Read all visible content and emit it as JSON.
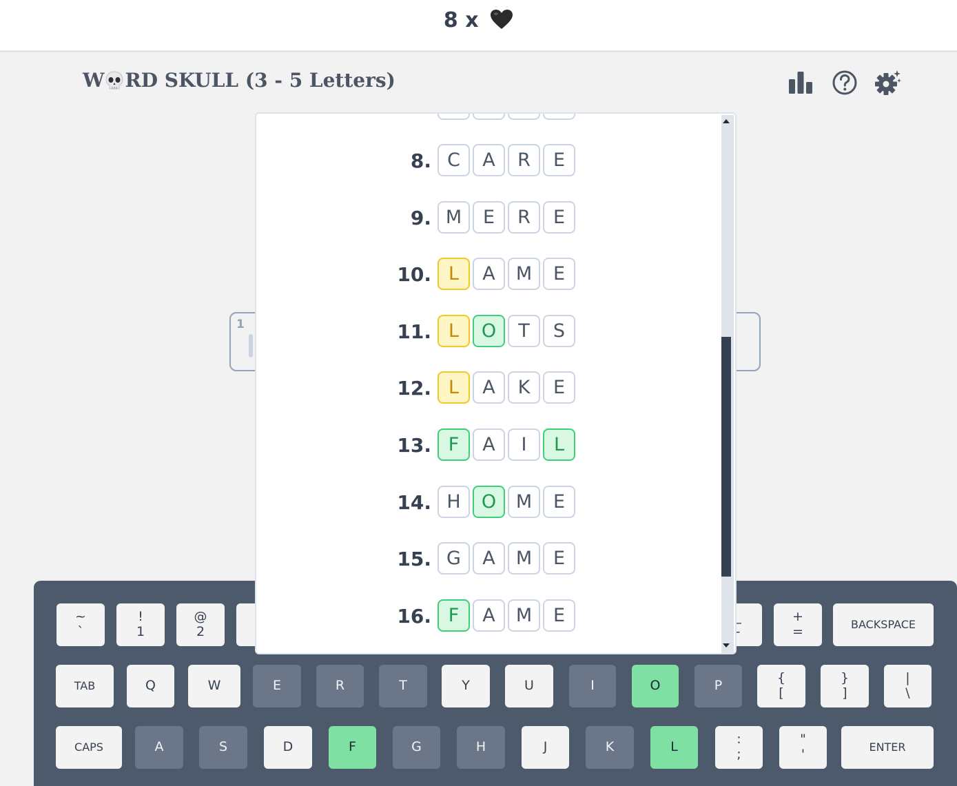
{
  "header": {
    "lives_count": "8",
    "lives_times": "x",
    "heart_icon": "black-heart-icon",
    "title_prefix": "W",
    "title_suffix": "RD SKULL (3 - 5 Letters)",
    "skull_icon": "skull-icon"
  },
  "toolbar": {
    "stats_icon": "bar-chart-icon",
    "help_icon": "help-circle-icon",
    "settings_icon": "gear-sparkle-icon"
  },
  "background_board": {
    "box_number": "1"
  },
  "colors": {
    "absent": "#6b7689",
    "correct": "#7fe0a3",
    "present_tile": "#fef6c4",
    "correct_tile": "#d9f8e4"
  },
  "history": [
    {
      "num": "8.",
      "letters": [
        "C",
        "A",
        "R",
        "E"
      ],
      "states": [
        "none",
        "none",
        "none",
        "none"
      ]
    },
    {
      "num": "9.",
      "letters": [
        "M",
        "E",
        "R",
        "E"
      ],
      "states": [
        "none",
        "none",
        "none",
        "none"
      ]
    },
    {
      "num": "10.",
      "letters": [
        "L",
        "A",
        "M",
        "E"
      ],
      "states": [
        "yellow",
        "none",
        "none",
        "none"
      ]
    },
    {
      "num": "11.",
      "letters": [
        "L",
        "O",
        "T",
        "S"
      ],
      "states": [
        "yellow",
        "green",
        "none",
        "none"
      ]
    },
    {
      "num": "12.",
      "letters": [
        "L",
        "A",
        "K",
        "E"
      ],
      "states": [
        "yellow",
        "none",
        "none",
        "none"
      ]
    },
    {
      "num": "13.",
      "letters": [
        "F",
        "A",
        "I",
        "L"
      ],
      "states": [
        "green",
        "none",
        "none",
        "green"
      ]
    },
    {
      "num": "14.",
      "letters": [
        "H",
        "O",
        "M",
        "E"
      ],
      "states": [
        "none",
        "green",
        "none",
        "none"
      ]
    },
    {
      "num": "15.",
      "letters": [
        "G",
        "A",
        "M",
        "E"
      ],
      "states": [
        "none",
        "none",
        "none",
        "none"
      ]
    },
    {
      "num": "16.",
      "letters": [
        "F",
        "A",
        "M",
        "E"
      ],
      "states": [
        "green",
        "none",
        "none",
        "none"
      ]
    }
  ],
  "keyboard": {
    "row1": [
      {
        "top": "~",
        "bottom": "`"
      },
      {
        "top": "!",
        "bottom": "1"
      },
      {
        "top": "@",
        "bottom": "2"
      },
      {
        "top": "_",
        "bottom": "-"
      },
      {
        "top": "+",
        "bottom": "="
      },
      {
        "label": "BACKSPACE"
      }
    ],
    "row2": [
      {
        "label": "TAB"
      },
      {
        "label": "Q",
        "state": "light"
      },
      {
        "label": "W",
        "state": "light"
      },
      {
        "label": "E",
        "state": "dark"
      },
      {
        "label": "R",
        "state": "dark"
      },
      {
        "label": "T",
        "state": "dark"
      },
      {
        "label": "Y",
        "state": "light"
      },
      {
        "label": "U",
        "state": "light"
      },
      {
        "label": "I",
        "state": "dark"
      },
      {
        "label": "O",
        "state": "green"
      },
      {
        "label": "P",
        "state": "dark"
      },
      {
        "top": "{",
        "bottom": "["
      },
      {
        "top": "}",
        "bottom": "]"
      },
      {
        "top": "|",
        "bottom": "\\"
      }
    ],
    "row3": [
      {
        "label": "CAPS"
      },
      {
        "label": "A",
        "state": "dark"
      },
      {
        "label": "S",
        "state": "dark"
      },
      {
        "label": "D",
        "state": "light"
      },
      {
        "label": "F",
        "state": "green"
      },
      {
        "label": "G",
        "state": "dark"
      },
      {
        "label": "H",
        "state": "dark"
      },
      {
        "label": "J",
        "state": "light"
      },
      {
        "label": "K",
        "state": "dark"
      },
      {
        "label": "L",
        "state": "green"
      },
      {
        "top": ":",
        "bottom": ";"
      },
      {
        "top": "\"",
        "bottom": "'"
      },
      {
        "label": "ENTER"
      }
    ]
  }
}
